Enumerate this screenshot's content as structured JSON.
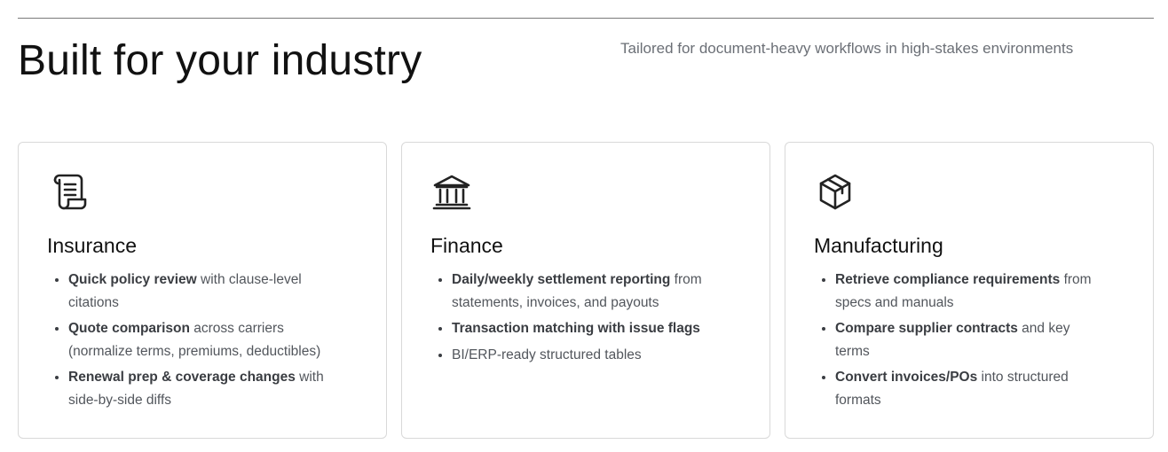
{
  "header": {
    "title": "Built for your industry",
    "subtitle": "Tailored for document-heavy workflows in high-stakes environments"
  },
  "cards": [
    {
      "icon": "scroll-icon",
      "title": "Insurance",
      "items": [
        {
          "bold": "Quick policy review",
          "rest": " with clause-level citations"
        },
        {
          "bold": "Quote comparison",
          "rest": " across carriers (normalize terms, premiums, deductibles)"
        },
        {
          "bold": "Renewal prep & coverage changes",
          "rest": " with side-by-side diffs"
        }
      ]
    },
    {
      "icon": "bank-icon",
      "title": "Finance",
      "items": [
        {
          "bold": "Daily/weekly settlement reporting",
          "rest": " from statements, invoices, and payouts"
        },
        {
          "bold": "Transaction matching with issue flags",
          "rest": ""
        },
        {
          "bold": "",
          "rest": "BI/ERP-ready structured tables"
        }
      ]
    },
    {
      "icon": "package-icon",
      "title": "Manufacturing",
      "items": [
        {
          "bold": "Retrieve compliance requirements",
          "rest": " from specs and manuals"
        },
        {
          "bold": "Compare supplier contracts",
          "rest": " and key terms"
        },
        {
          "bold": "Convert invoices/POs",
          "rest": " into structured formats"
        }
      ]
    }
  ]
}
